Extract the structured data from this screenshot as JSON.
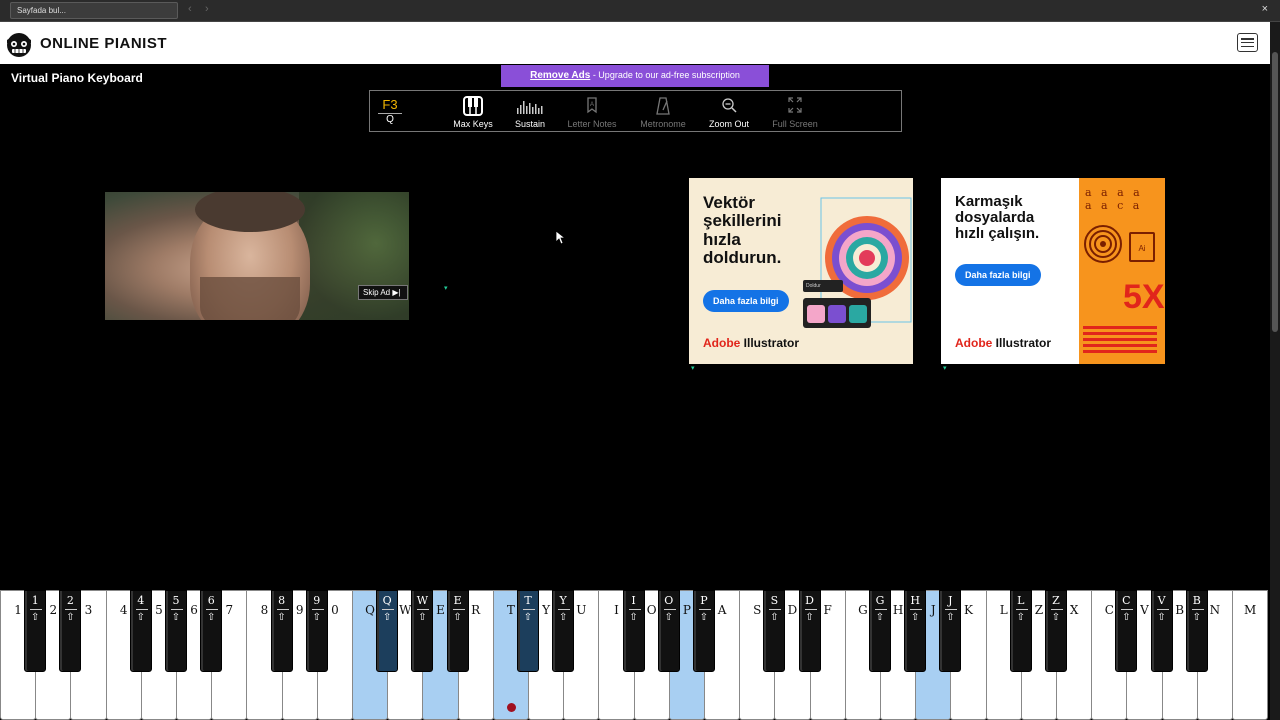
{
  "findbar": {
    "placeholder": "Sayfada bul...",
    "close": "×",
    "prev": "‹",
    "next": "›"
  },
  "header": {
    "logo_text": "ONLINE PIANIST",
    "menu_icon": "hamburger-icon"
  },
  "page_title": "Virtual Piano Keyboard",
  "remove_ads": {
    "link": "Remove Ads",
    "text": " - Upgrade to our ad-free subscription",
    "color": "#8a4fd8"
  },
  "toolbar": {
    "note_top": "F3",
    "note_bottom": "Q",
    "items": [
      {
        "label": "Max Keys",
        "icon": "piano-keys-icon",
        "enabled": true
      },
      {
        "label": "Sustain",
        "icon": "sustain-bars-icon",
        "enabled": true
      },
      {
        "label": "Letter Notes",
        "icon": "letter-note-icon",
        "enabled": false
      },
      {
        "label": "Metronome",
        "icon": "metronome-icon",
        "enabled": false
      },
      {
        "label": "Zoom Out",
        "icon": "zoom-out-icon",
        "enabled": true
      },
      {
        "label": "Full Screen",
        "icon": "fullscreen-icon",
        "enabled": false
      }
    ]
  },
  "video_ad": {
    "skip": "Skip Ad ▶|"
  },
  "ad1": {
    "headline": [
      "Vektör",
      "şekillerini",
      "hızla",
      "doldurun."
    ],
    "cta": "Daha fazla bilgi",
    "brand_prefix": "Adobe",
    "brand": " Illustrator",
    "panel_label": "Doldur"
  },
  "ad2": {
    "headline": [
      "Karmaşık",
      "dosyalarda",
      "hızlı çalışın."
    ],
    "cta": "Daha fazla bilgi",
    "brand_prefix": "Adobe",
    "brand": " Illustrator",
    "badge": "5X",
    "ai_label": "Ai"
  },
  "keyboard": {
    "white_keys": [
      "1",
      "2",
      "3",
      "4",
      "5",
      "6",
      "7",
      "8",
      "9",
      "0",
      "Q",
      "W",
      "E",
      "R",
      "T",
      "Y",
      "U",
      "I",
      "O",
      "P",
      "A",
      "S",
      "D",
      "F",
      "G",
      "H",
      "J",
      "K",
      "L",
      "Z",
      "X",
      "C",
      "V",
      "B",
      "N",
      "M"
    ],
    "lit_white": [
      "Q",
      "E",
      "T",
      "P",
      "J"
    ],
    "black_keys": [
      "1",
      "2",
      "4",
      "5",
      "6",
      "8",
      "9",
      "Q",
      "W",
      "E",
      "T",
      "Y",
      "I",
      "O",
      "P",
      "S",
      "D",
      "G",
      "H",
      "J",
      "L",
      "Z",
      "C",
      "V",
      "B"
    ],
    "lit_black": [
      "Q",
      "T"
    ],
    "shift_symbol": "⇧",
    "sep": "+"
  }
}
